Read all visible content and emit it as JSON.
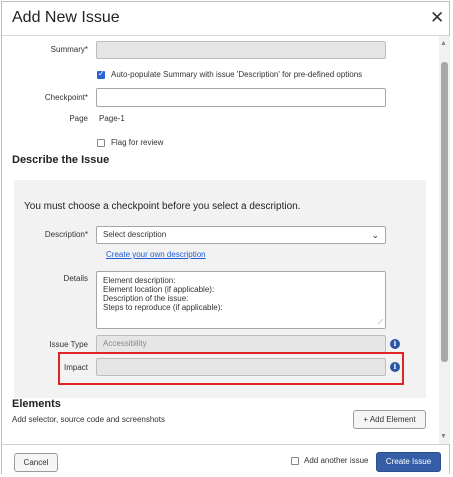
{
  "dialog": {
    "title": "Add New Issue",
    "close_icon": "close-icon"
  },
  "summary": {
    "label": "Summary*",
    "value": ""
  },
  "auto_populate": {
    "label": "Auto-populate Summary with issue 'Description' for pre-defined options",
    "checked": true
  },
  "checkpoint": {
    "label": "Checkpoint*",
    "value": ""
  },
  "page": {
    "label": "Page",
    "value": "Page-1"
  },
  "flag": {
    "label": "Flag for review",
    "checked": false
  },
  "describe": {
    "heading": "Describe the Issue",
    "notice": "You must choose a checkpoint before you select a description.",
    "description_label": "Description*",
    "description_value": "Select description",
    "create_link": "Create your own description",
    "details_label": "Details",
    "details_lines": [
      "Element description:",
      "Element location (if applicable):",
      "Description of the issue:",
      "Steps to reproduce (if applicable):"
    ],
    "issue_type_label": "Issue Type",
    "issue_type_placeholder": "Accessibility",
    "impact_label": "Impact",
    "impact_value": ""
  },
  "elements": {
    "heading": "Elements",
    "subtitle": "Add selector, source code and screenshots",
    "add_button": "+ Add Element"
  },
  "footer": {
    "cancel": "Cancel",
    "add_another": "Add another issue",
    "add_another_checked": false,
    "create": "Create Issue"
  },
  "colors": {
    "primary": "#355ea6",
    "highlight": "#e02424",
    "link": "#1f5bd6",
    "info": "#2a56a8"
  }
}
